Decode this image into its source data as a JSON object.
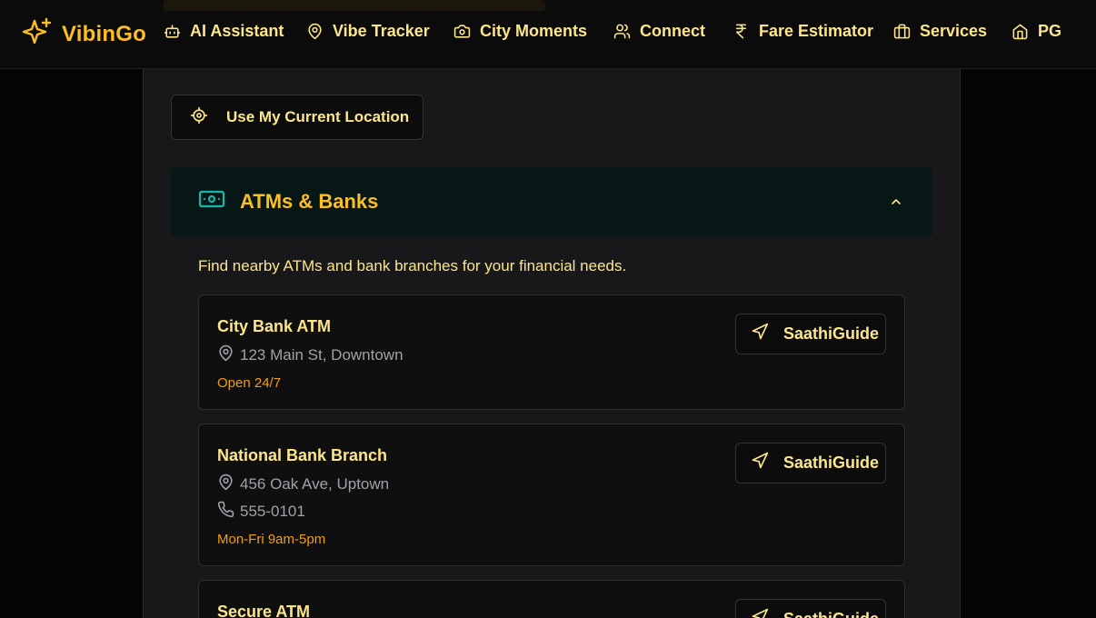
{
  "header": {
    "brand": "VibinGo",
    "nav": [
      {
        "label": "AI Assistant",
        "icon": "bot-icon"
      },
      {
        "label": "Vibe Tracker",
        "icon": "map-pin-icon"
      },
      {
        "label": "City Moments",
        "icon": "camera-icon"
      },
      {
        "label": "Connect",
        "icon": "users-icon"
      },
      {
        "label": "Fare Estimator",
        "icon": "rupee-icon"
      },
      {
        "label": "Services",
        "icon": "briefcase-icon"
      },
      {
        "label": "PG",
        "icon": "home-icon"
      }
    ]
  },
  "location_button": "Use My Current Location",
  "section": {
    "title": "ATMs & Banks",
    "icon": "banknote-icon",
    "description": "Find nearby ATMs and bank branches for your financial needs."
  },
  "places": [
    {
      "name": "City Bank ATM",
      "address": "123 Main St, Downtown",
      "phone": "",
      "hours": "Open 24/7",
      "action": "SaathiGuide"
    },
    {
      "name": "National Bank Branch",
      "address": "456 Oak Ave, Uptown",
      "phone": "555-0101",
      "hours": "Mon-Fri 9am-5pm",
      "action": "SaathiGuide"
    },
    {
      "name": "Secure ATM",
      "address": "",
      "phone": "",
      "hours": "",
      "action": "SaathiGuide"
    }
  ],
  "colors": {
    "accent": "#fbbf24",
    "text": "#fde68a",
    "muted": "#a1a1aa",
    "teal": "#14b8a6",
    "hours": "#f59e0b"
  }
}
